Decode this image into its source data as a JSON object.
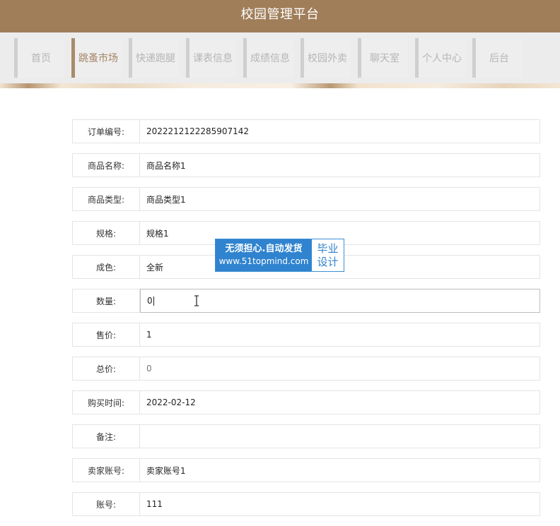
{
  "header": {
    "title": "校园管理平台"
  },
  "nav": {
    "items": [
      {
        "label": "首页",
        "active": false
      },
      {
        "label": "跳蚤市场",
        "active": true
      },
      {
        "label": "快递跑腿",
        "active": false
      },
      {
        "label": "课表信息",
        "active": false
      },
      {
        "label": "成绩信息",
        "active": false
      },
      {
        "label": "校园外卖",
        "active": false
      },
      {
        "label": "聊天室",
        "active": false
      },
      {
        "label": "个人中心",
        "active": false
      },
      {
        "label": "后台",
        "active": false
      }
    ]
  },
  "form": {
    "fields": [
      {
        "label": "订单编号:",
        "value": "2022212122285907142"
      },
      {
        "label": "商品名称:",
        "value": "商品名称1"
      },
      {
        "label": "商品类型:",
        "value": "商品类型1"
      },
      {
        "label": "规格:",
        "value": "规格1"
      },
      {
        "label": "成色:",
        "value": "全新"
      },
      {
        "label": "数量:",
        "value": "0"
      },
      {
        "label": "售价:",
        "value": "1"
      },
      {
        "label": "总价:",
        "value": "0"
      },
      {
        "label": "购买时间:",
        "value": "2022-02-12"
      },
      {
        "label": "备注:",
        "value": ""
      },
      {
        "label": "卖家账号:",
        "value": "卖家账号1"
      },
      {
        "label": "账号:",
        "value": "111"
      }
    ]
  },
  "watermark": {
    "line1": "无须担心.自动发货",
    "line2": "www.51topmind.com",
    "right1": "毕业",
    "right2": "设计"
  },
  "colors": {
    "header_bg": "#a07e5a",
    "nav_active_text": "#a48464",
    "watermark_blue": "#2f83cf"
  }
}
